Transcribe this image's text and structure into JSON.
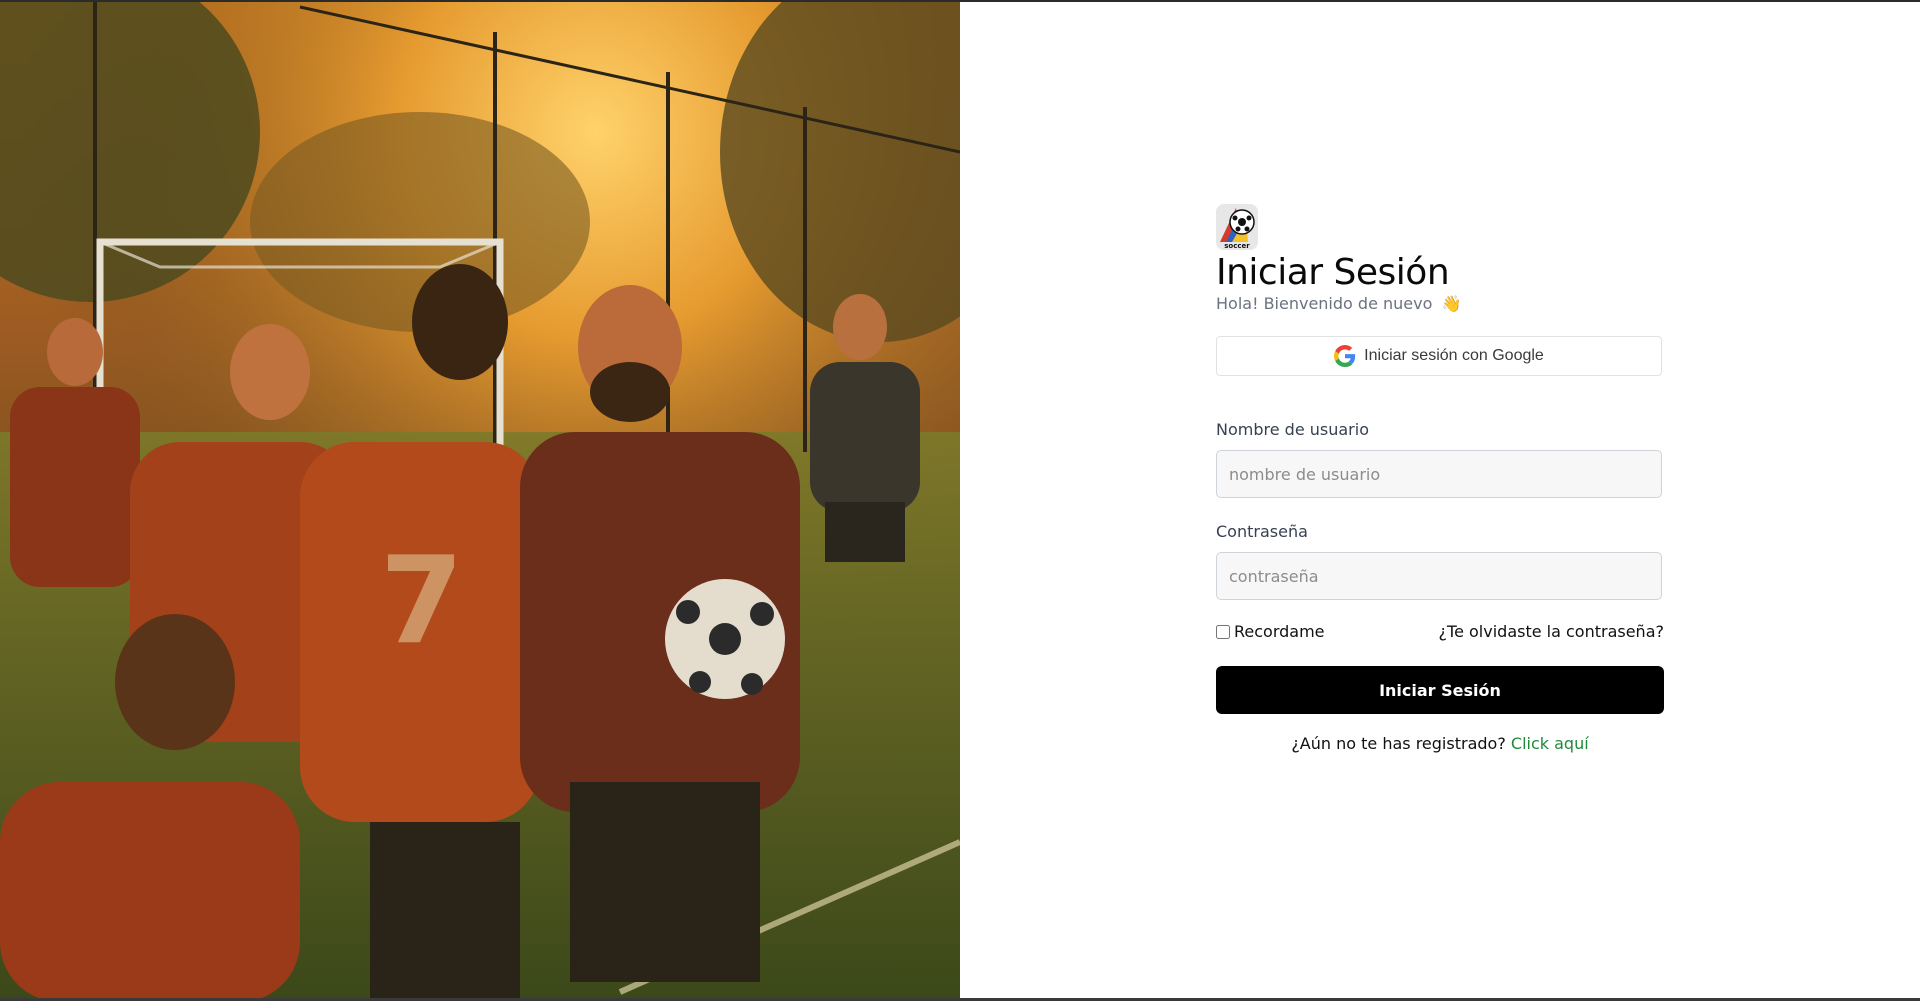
{
  "hero": {
    "image_alt": "Ilustración de jugadores de fútbol al atardecer",
    "jersey_number": "7"
  },
  "brand": {
    "logo_text": "soccer",
    "icon": "soccer-ball-logo-icon"
  },
  "login": {
    "title": "Iniciar Sesión",
    "subtitle": "Hola! Bienvenido de nuevo",
    "wave_emoji": "👋",
    "google_label": "Iniciar sesión con Google",
    "username_label": "Nombre de usuario",
    "username_placeholder": "nombre de usuario",
    "username_value": "",
    "password_label": "Contraseña",
    "password_placeholder": "contraseña",
    "password_value": "",
    "remember_label": "Recordame",
    "remember_checked": false,
    "forgot_label": "¿Te olvidaste la contraseña?",
    "submit_label": "Iniciar Sesión",
    "register_text": "¿Aún no te has registrado?",
    "register_link": "Click aquí"
  },
  "colors": {
    "primary_button": "#000000",
    "link_green": "#1f8b3a",
    "subtitle_gray": "#6b7280"
  }
}
